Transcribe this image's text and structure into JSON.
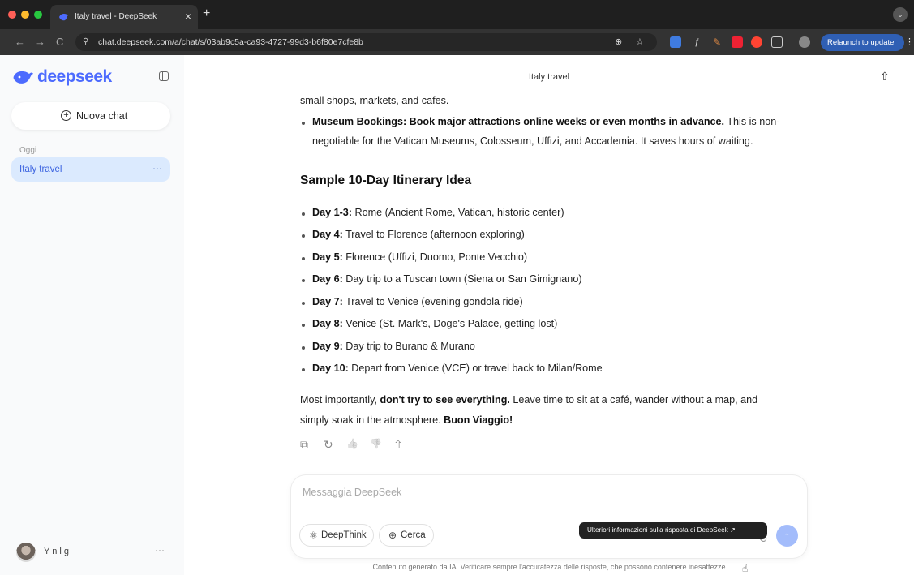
{
  "browser": {
    "tab_title": "Italy travel - DeepSeek",
    "tab_close": "×",
    "new_tab": "+",
    "tab_menu": "⌄",
    "url": "chat.deepseek.com/a/chat/s/03ab9c5a-ca93-4727-99d3-b6f80e7cfe8b",
    "relaunch_label": "Relaunch to update",
    "kebab": "⋮",
    "nav": {
      "back": "←",
      "forward": "→",
      "reload": "C"
    },
    "site_icon": "⚲",
    "zoom_icon": "⊕",
    "star_icon": "☆"
  },
  "sidebar": {
    "logo_text": "deepseek",
    "new_chat_label": "Nuova chat",
    "new_chat_icon": "+",
    "section_label": "Oggi",
    "chat_items": [
      {
        "label": "Italy travel",
        "more": "···"
      }
    ],
    "user_name": "Y   n l   g",
    "user_more": "···"
  },
  "main": {
    "conversation_title": "Italy travel",
    "share_icon": "⇧",
    "intro_cut": "small shops, markets, and cafes.",
    "museum_bold": "Museum Bookings: Book major attractions online weeks or even months in advance.",
    "museum_rest": " This is non-",
    "museum_line2": "negotiable for the Vatican Museums, Colosseum, Uffizi, and Accademia. It saves hours of waiting.",
    "heading": "Sample 10-Day Itinerary Idea",
    "itinerary": [
      {
        "day": "Day 1-3:",
        "text": " Rome (Ancient Rome, Vatican, historic center)"
      },
      {
        "day": "Day 4:",
        "text": " Travel to Florence (afternoon exploring)"
      },
      {
        "day": "Day 5:",
        "text": " Florence (Uffizi, Duomo, Ponte Vecchio)"
      },
      {
        "day": "Day 6:",
        "text": " Day trip to a Tuscan town (Siena or San Gimignano)"
      },
      {
        "day": "Day 7:",
        "text": " Travel to Venice (evening gondola ride)"
      },
      {
        "day": "Day 8:",
        "text": " Venice (St. Mark's, Doge's Palace, getting lost)"
      },
      {
        "day": "Day 9:",
        "text": " Day trip to Burano & Murano"
      },
      {
        "day": "Day 10:",
        "text": " Depart from Venice (VCE) or travel back to Milan/Rome"
      }
    ],
    "closing_a": "Most importantly, ",
    "closing_bold": "don't try to see everything.",
    "closing_b": " Leave time to sit at a café, wander without a map, and",
    "closing_line2": "simply soak in the atmosphere. ",
    "closing_bold2": "Buon Viaggio!",
    "actions": {
      "copy_icon": "⧉",
      "regenerate_icon": "↻",
      "like_icon": "👍",
      "dislike_icon": "👎",
      "share_icon": "⇧"
    }
  },
  "composer": {
    "placeholder": "Messaggia DeepSeek",
    "deepthink_label": "DeepThink",
    "deepthink_icon": "⚛",
    "search_label": "Cerca",
    "search_icon": "⊕",
    "attach_icon": "📎",
    "send_icon": "↑"
  },
  "tooltip": "Ulteriori informazioni sulla risposta di DeepSeek ↗",
  "disclaimer": "Contenuto generato da IA. Verificare sempre l'accuratezza delle risposte, che possono contenere inesattezze",
  "colors": {
    "accent": "#4d6bfe",
    "selected_bg": "#dbeafe",
    "send_button": "#a3bcfb",
    "relaunch": "#2f5fb4"
  }
}
